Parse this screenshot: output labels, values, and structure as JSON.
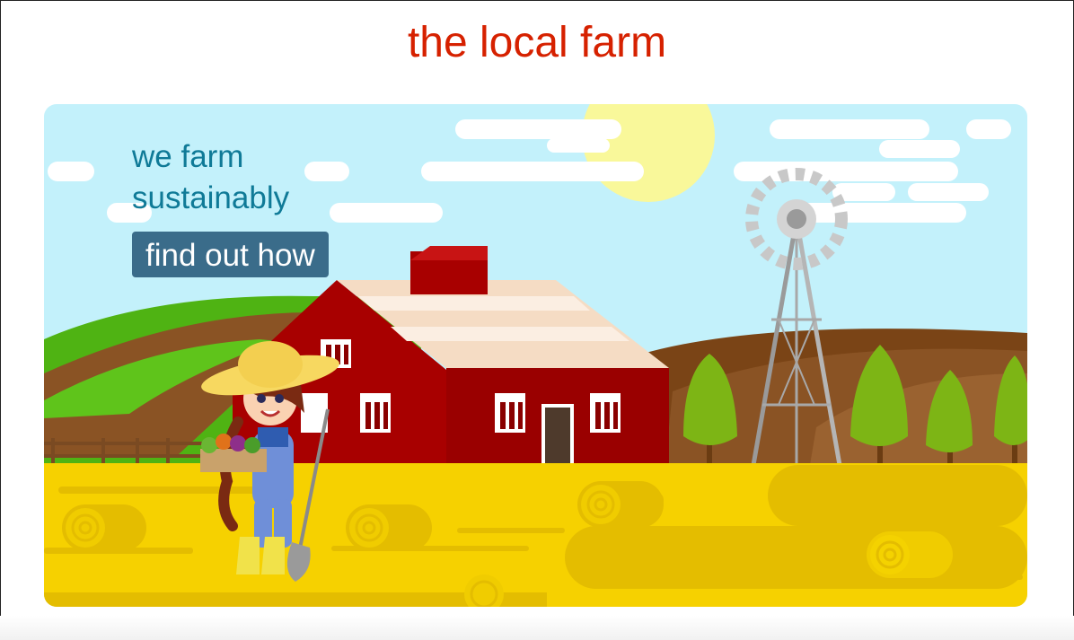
{
  "header": {
    "title": "the local farm"
  },
  "hero": {
    "tagline": "we farm sustainably",
    "cta_label": "find out how",
    "illustration": "farm-scene-illustration",
    "icons": [
      "sun-icon",
      "cloud-icon",
      "barn-icon",
      "windmill-icon",
      "tree-icon",
      "hay-bale-icon",
      "farmer-girl-icon",
      "fence-icon"
    ]
  },
  "colors": {
    "title": "#d62100",
    "tagline": "#0f7a97",
    "button_bg": "#3a6c8a",
    "button_text": "#ffffff",
    "sky": "#c3f1fb",
    "field": "#f6d100",
    "barn": "#a80000"
  }
}
